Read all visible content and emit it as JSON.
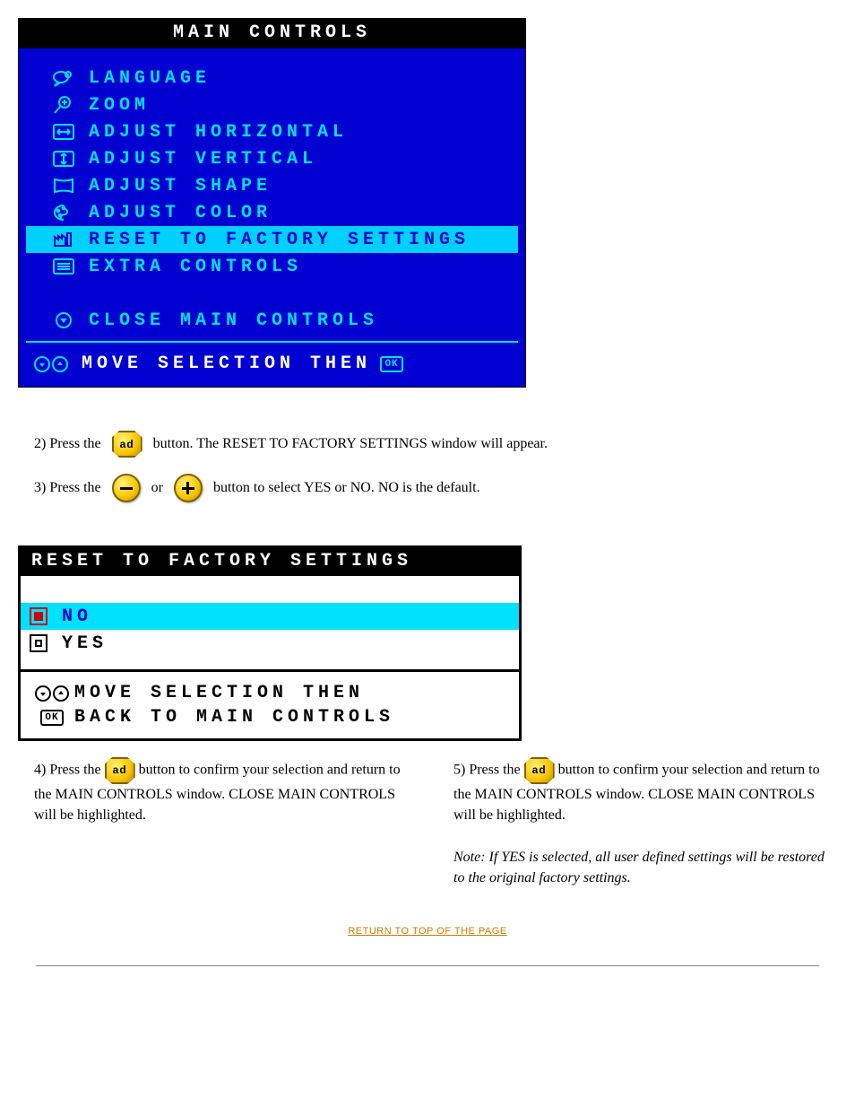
{
  "panel1": {
    "title": "MAIN CONTROLS",
    "items": [
      {
        "icon": "speech-icon",
        "label": "LANGUAGE"
      },
      {
        "icon": "zoom-icon",
        "label": "ZOOM"
      },
      {
        "icon": "horiz-icon",
        "label": "ADJUST HORIZONTAL"
      },
      {
        "icon": "vert-icon",
        "label": "ADJUST VERTICAL"
      },
      {
        "icon": "shape-icon",
        "label": "ADJUST SHAPE"
      },
      {
        "icon": "palette-icon",
        "label": "ADJUST COLOR"
      },
      {
        "icon": "factory-icon",
        "label": "RESET TO FACTORY SETTINGS",
        "selected": true
      },
      {
        "icon": "menu-icon",
        "label": "EXTRA CONTROLS"
      },
      {
        "icon": "",
        "label": "",
        "blank": true
      },
      {
        "icon": "down-icon",
        "label": "CLOSE MAIN CONTROLS"
      }
    ],
    "footer_text": "MOVE SELECTION THEN",
    "footer_ok": "OK"
  },
  "step2": {
    "prefix": "2) Press the ",
    "suffix": " button. The RESET TO FACTORY SETTINGS window will appear."
  },
  "step3": {
    "prefix": "3) Press the ",
    "mid": " or ",
    "suffix": " button to select YES or NO. NO is the default."
  },
  "panel2": {
    "title": "RESET TO FACTORY SETTINGS",
    "options": [
      {
        "label": "NO",
        "selected": true
      },
      {
        "label": "YES",
        "selected": false
      }
    ],
    "foot1": "MOVE SELECTION THEN",
    "foot2_ok": "OK",
    "foot2": "BACK TO MAIN CONTROLS"
  },
  "step4": {
    "prefix": "4) Press the ",
    "body": " button to confirm your selection and return to the MAIN CONTROLS window. CLOSE MAIN CONTROLS will be highlighted."
  },
  "step5": {
    "note_italic": "Note: If YES is selected, all user defined settings will be restored to the original factory settings.",
    "prefix": "5) Press the ",
    "body": " button to confirm your selection and return to the MAIN CONTROLS window. CLOSE MAIN CONTROLS will be highlighted."
  },
  "return_link": "RETURN TO TOP OF THE PAGE"
}
